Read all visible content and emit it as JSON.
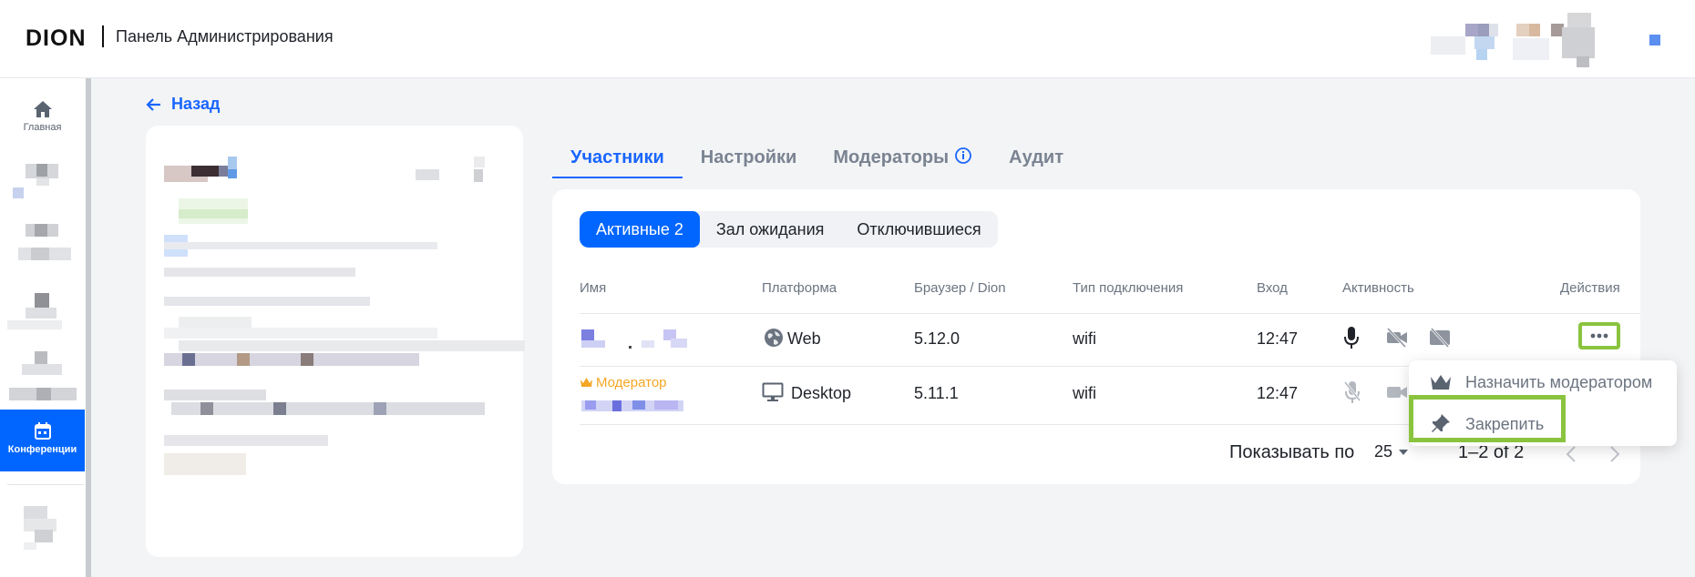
{
  "header": {
    "logo": "DION",
    "app_title": "Панель Администрирования"
  },
  "sidebar": {
    "home_label": "Главная",
    "conferences_label": "Конференции"
  },
  "back_label": "Назад",
  "tabs": [
    {
      "label": "Участники"
    },
    {
      "label": "Настройки"
    },
    {
      "label": "Модераторы"
    },
    {
      "label": "Аудит"
    }
  ],
  "segments": {
    "active": "Активные 2",
    "waiting": "Зал ожидания",
    "left": "Отключившиеся"
  },
  "table": {
    "columns": [
      "Имя",
      "Платформа",
      "Браузер / Dion",
      "Тип подключения",
      "Вход",
      "Активность",
      "Действия"
    ],
    "rows": [
      {
        "badge": "",
        "platform": "Web",
        "version": "5.12.0",
        "connection": "wifi",
        "time": "12:47"
      },
      {
        "badge": "Модератор",
        "platform": "Desktop",
        "version": "5.11.1",
        "connection": "wifi",
        "time": "12:47"
      }
    ]
  },
  "pagination": {
    "per_page_label": "Показывать по",
    "per_page_value": "25",
    "range": "1–2 of 2"
  },
  "context_menu": {
    "assign_moderator": "Назначить модератором",
    "pin": "Закрепить"
  },
  "colors": {
    "accent": "#0066ff",
    "highlight": "#8ac43f",
    "moderator": "#f5a623"
  }
}
